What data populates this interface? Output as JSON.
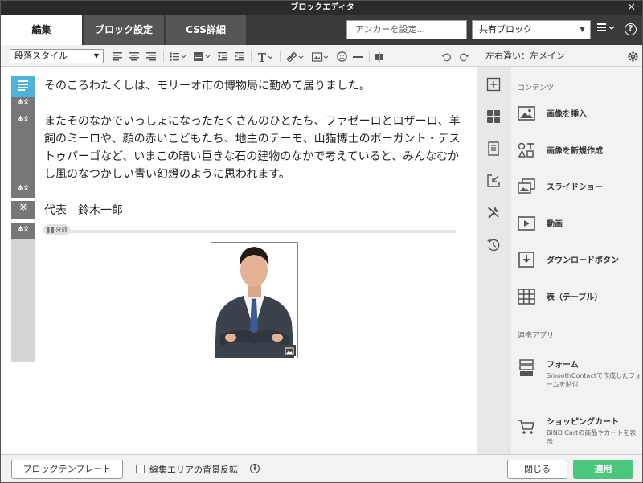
{
  "window": {
    "title": "ブロックエディタ",
    "close_glyph": "✕"
  },
  "tabs": [
    {
      "label": "編集",
      "active": true
    },
    {
      "label": "ブロック設定",
      "active": false
    },
    {
      "label": "CSS詳細",
      "active": false
    }
  ],
  "anchor": {
    "placeholder": "アンカーを設定..."
  },
  "shared_block": {
    "value": "共有ブロック"
  },
  "toolbar": {
    "paragraph_style": "段落スタイル"
  },
  "editor": {
    "gutter_labels": [
      "本文",
      "本文",
      "本文",
      "本文"
    ],
    "ref_mark": "※",
    "paragraphs": [
      "そのころわたくしは、モリーオ市の博物局に勤めて居りました。",
      "またそのなかでいっしょになったたくさんのひとたち、ファゼーロとロザーロ、羊飼のミーロや、顔の赤いこどもたち、地主のテーモ、山猫博士のボーガント・デストゥパーゴなど、いまこの暗い巨きな石の建物のなかで考えていると、みんなむかし風のなつかしい青い幻燈のように思われます。",
      "代表　鈴木一郎"
    ],
    "divider_label": "分割"
  },
  "sidebar": {
    "header": "左右違い：左メイン",
    "section_contents": "コンテンツ",
    "items": [
      {
        "label": "画像を挿入",
        "icon": "image-icon"
      },
      {
        "label": "画像を新規作成",
        "icon": "shapes-text-icon"
      },
      {
        "label": "スライドショー",
        "icon": "slideshow-icon"
      },
      {
        "label": "動画",
        "icon": "video-icon"
      },
      {
        "label": "ダウンロードボタン",
        "icon": "download-icon"
      },
      {
        "label": "表（テーブル）",
        "icon": "table-icon"
      }
    ],
    "section_apps": "連携アプリ",
    "apps": [
      {
        "label": "フォーム",
        "desc": "SmoothContactで作成したフォームを貼付",
        "icon": "form-icon"
      },
      {
        "label": "ショッピングカート",
        "desc": "BiND Cartの商品やカートを表示",
        "icon": "cart-icon"
      }
    ]
  },
  "footer": {
    "template_button": "ブロックテンプレート",
    "invert_label": "編集エリアの背景反転",
    "close_button": "閉じる",
    "apply_button": "適用"
  },
  "colors": {
    "accent": "#4cc77e",
    "tab_bar": "#3a3a3a",
    "gutter": "#777777",
    "gutter_active": "#4fb3d9"
  }
}
